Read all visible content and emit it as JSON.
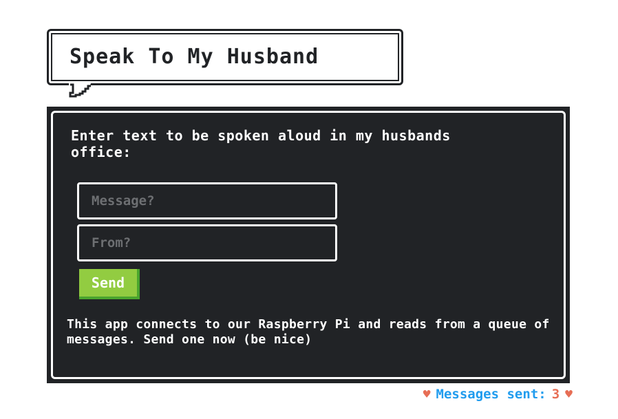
{
  "title": "Speak To My Husband",
  "intro": "Enter text to be spoken aloud in my husbands office:",
  "form": {
    "message_placeholder": "Message?",
    "from_placeholder": "From?",
    "send_label": "Send"
  },
  "footnote": "This app connects to our Raspberry Pi and reads from a queue of messages. Send one now (be nice)",
  "counter": {
    "label": "Messages sent:",
    "value": "3",
    "icon": "heart-icon",
    "heart_glyph": "♥"
  },
  "colors": {
    "panel": "#212326",
    "send": "#92cc41",
    "counter_label": "#209cee",
    "heart": "#e76e55"
  }
}
